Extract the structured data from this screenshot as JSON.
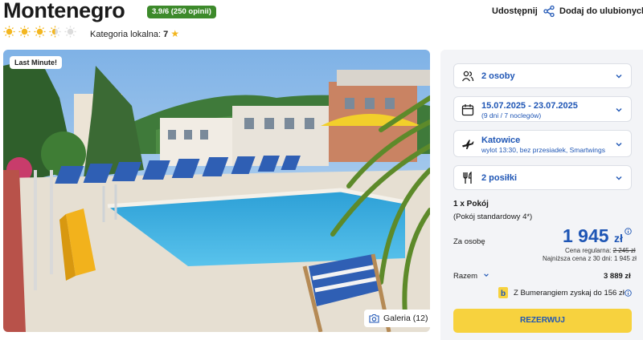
{
  "header": {
    "title": "Montenegro",
    "rating": "3.9/6 (250 opinii)",
    "suns_rating": 3.5,
    "suns_max": 5,
    "category_label": "Kategoria lokalna:",
    "category_value": "7",
    "share_label": "Udostępnij",
    "favorite_label": "Dodaj do ulubionych"
  },
  "photo": {
    "badge": "Last Minute!",
    "gallery_label": "Galeria (12)",
    "icons": {
      "gallery": "camera-icon"
    }
  },
  "booking": {
    "persons": {
      "label": "2 osoby",
      "icon": "people-icon"
    },
    "dates": {
      "label": "15.07.2025 - 23.07.2025",
      "sub": "(9 dni / 7 noclegów)",
      "icon": "calendar-icon"
    },
    "flight": {
      "label": "Katowice",
      "sub": "wylot 13:30, bez przesiadek, Smartwings",
      "icon": "plane-icon"
    },
    "meals": {
      "label": "2 posiłki",
      "icon": "cutlery-icon"
    },
    "room_count": "1 x Pokój",
    "room_type": "(Pokój standardowy 4*)",
    "per_person_label": "Za osobę",
    "price": "1 945",
    "currency": "zł",
    "regular_label": "Cena regularna:",
    "regular_price": "2 245 zł",
    "lowest_price": "Najniższa cena z 30 dni: 1 945 zł",
    "total_label": "Razem",
    "total_value": "3 889 zł",
    "bumerang": "Z Bumerangiem zyskaj do 156 zł",
    "reserve_label": "REZERWUJ"
  },
  "colors": {
    "accent_blue": "#1f56b5",
    "rating_green": "#3d8a2b",
    "sun_yellow": "#f3b61f",
    "reserve_yellow": "#f7d23e"
  }
}
